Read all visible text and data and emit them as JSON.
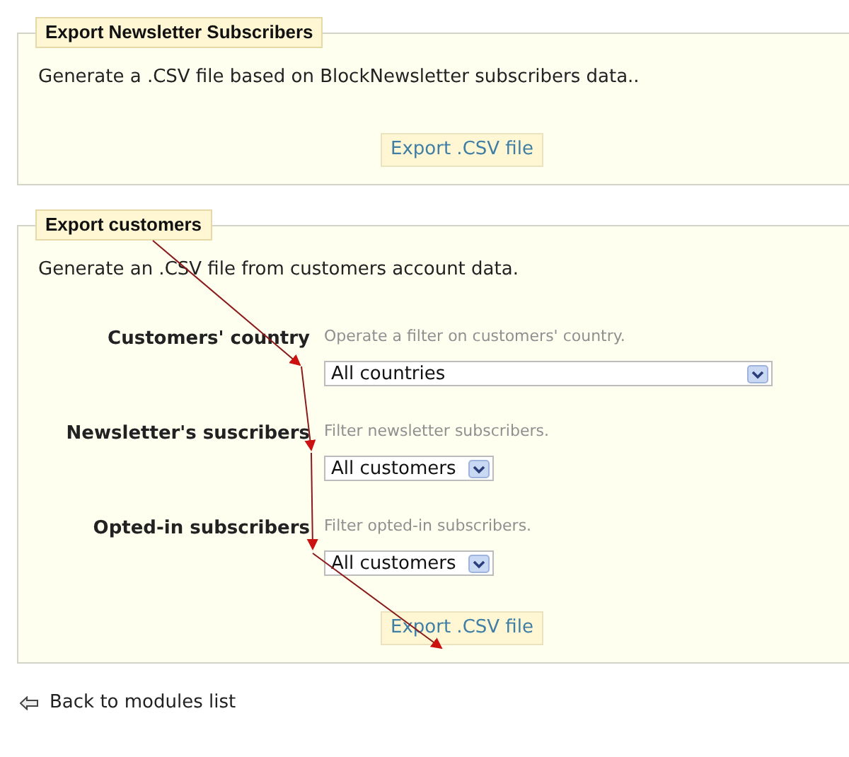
{
  "sections": [
    {
      "legend": "Export Newsletter Subscribers",
      "description": "Generate a .CSV file based on BlockNewsletter subscribers data..",
      "button": "Export .CSV file"
    },
    {
      "legend": "Export customers",
      "description": "Generate an .CSV file from customers account data.",
      "filters": [
        {
          "label": "Customers' country",
          "hint": "Operate a filter on customers' country.",
          "value": "All countries"
        },
        {
          "label": "Newsletter's suscribers",
          "hint": "Filter newsletter subscribers.",
          "value": "All customers"
        },
        {
          "label": "Opted-in subscribers",
          "hint": "Filter opted-in subscribers.",
          "value": "All customers"
        }
      ],
      "button": "Export .CSV file"
    }
  ],
  "back_link": {
    "label": "Back to modules list"
  }
}
